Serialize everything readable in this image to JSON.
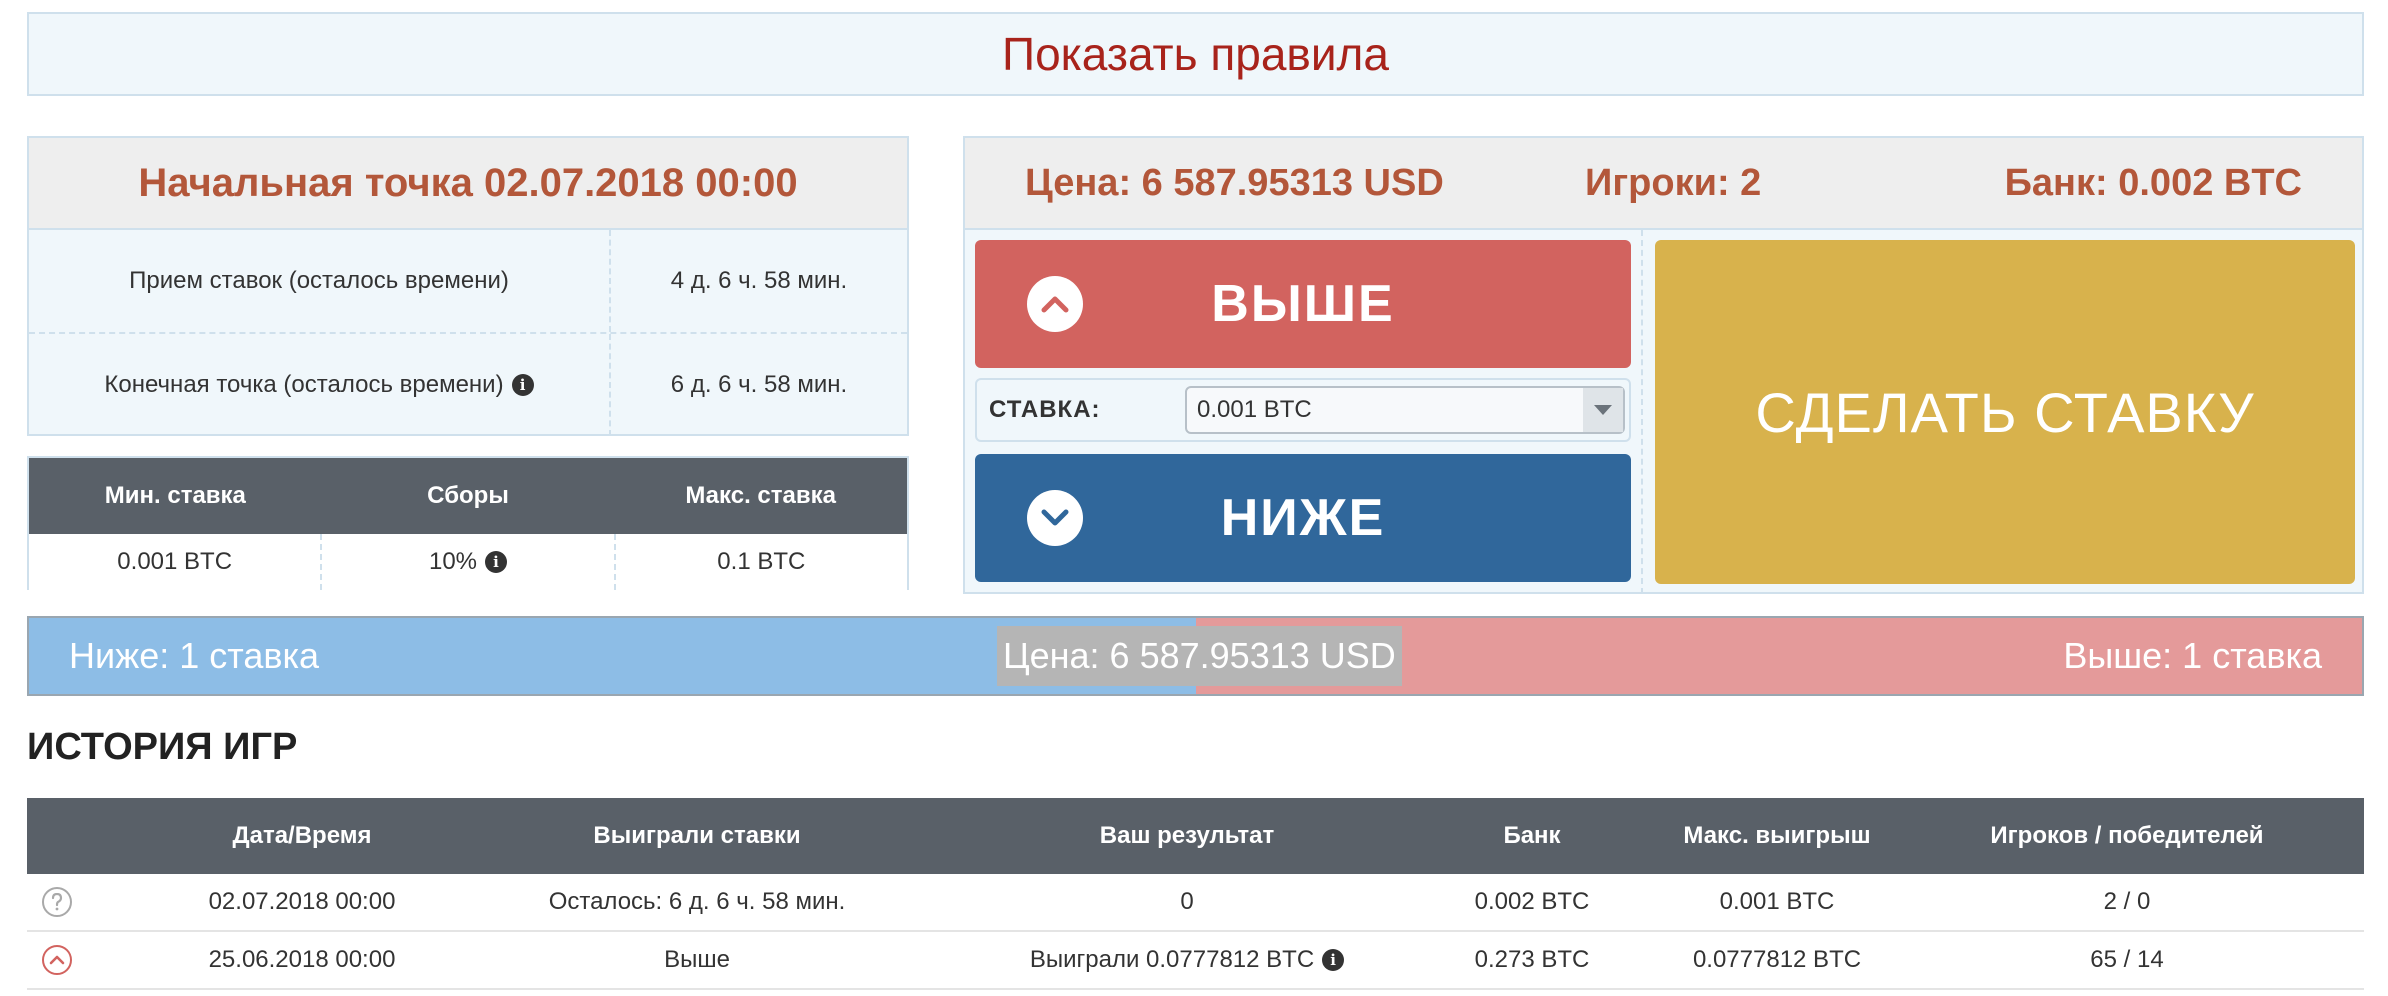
{
  "rules": {
    "label": "Показать правила"
  },
  "start": {
    "title": "Начальная точка 02.07.2018 00:00",
    "rows": [
      {
        "label": "Прием ставок (осталось времени)",
        "value": "4 д. 6 ч. 58 мин."
      },
      {
        "label": "Конечная точка (осталось времени)",
        "value": "6 д. 6 ч. 58 мин."
      }
    ]
  },
  "limits": {
    "headers": [
      "Мин. ставка",
      "Сборы",
      "Макс. ставка"
    ],
    "values": [
      "0.001 BTC",
      "10%",
      "0.1 BTC"
    ]
  },
  "game": {
    "price": "Цена: 6 587.95313 USD",
    "players": "Игроки: 2",
    "bank": "Банк: 0.002 BTC",
    "up_label": "ВЫШЕ",
    "down_label": "НИЖЕ",
    "bet_label": "СДЕЛАТЬ СТАВКУ",
    "stake_label": "СТАВКА:",
    "stake_value": "0.001 BTC"
  },
  "balance": {
    "low_text": "Ниже: 1 ставка",
    "high_text": "Выше: 1 ставка",
    "price_text": "Цена: 6 587.95313 USD",
    "low_share": 0.5,
    "low_color": "#8dbde6",
    "high_color": "#e49a9a"
  },
  "history": {
    "title": "ИСТОРИЯ ИГР",
    "headers": [
      "Дата/Время",
      "Выиграли ставки",
      "Ваш результат",
      "Банк",
      "Макс. выигрыш",
      "Игроков / победителей"
    ],
    "rows": [
      {
        "icon": "question-circle-icon",
        "date": "02.07.2018 00:00",
        "won": "Осталось: 6 д. 6 ч. 58 мин.",
        "result": "0",
        "bank": "0.002 BTC",
        "max": "0.001 BTC",
        "players": "2 / 0"
      },
      {
        "icon": "chevron-up-circle-icon",
        "date": "25.06.2018 00:00",
        "won": "Выше",
        "result": "Выиграли 0.0777812 BTC",
        "bank": "0.273 BTC",
        "max": "0.0777812 BTC",
        "players": "65 / 14"
      }
    ]
  },
  "colors": {
    "up": "#d2635f",
    "down": "#30679b",
    "bet": "#d8b24c",
    "accent_text": "#b3573a",
    "rules_text": "#a8231b"
  }
}
